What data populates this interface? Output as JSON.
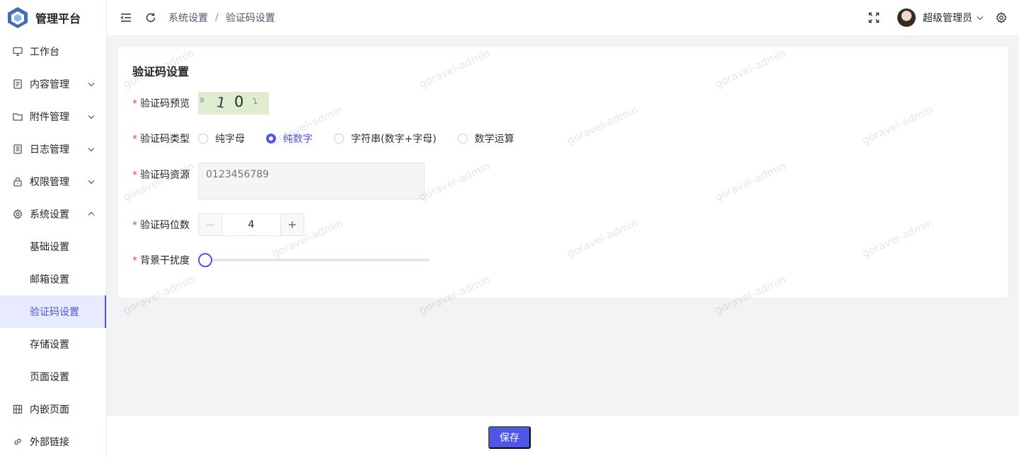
{
  "app": {
    "title": "管理平台"
  },
  "sidebar": {
    "items": [
      {
        "label": "工作台",
        "icon": "monitor-icon",
        "expandable": false
      },
      {
        "label": "内容管理",
        "icon": "document-icon",
        "expandable": true
      },
      {
        "label": "附件管理",
        "icon": "folder-icon",
        "expandable": true
      },
      {
        "label": "日志管理",
        "icon": "list-icon",
        "expandable": true
      },
      {
        "label": "权限管理",
        "icon": "lock-icon",
        "expandable": true
      },
      {
        "label": "系统设置",
        "icon": "gear-icon",
        "expandable": true,
        "expanded": true
      }
    ],
    "sub_items": [
      {
        "label": "基础设置"
      },
      {
        "label": "邮箱设置"
      },
      {
        "label": "验证码设置",
        "active": true
      },
      {
        "label": "存储设置"
      },
      {
        "label": "页面设置"
      }
    ],
    "bottom_items": [
      {
        "label": "内嵌页面",
        "icon": "table-icon"
      },
      {
        "label": "外部链接",
        "icon": "link-icon"
      }
    ]
  },
  "header": {
    "breadcrumb": [
      "系统设置",
      "验证码设置"
    ],
    "breadcrumb_sep": "/",
    "user_name": "超级管理员"
  },
  "form": {
    "title": "验证码设置",
    "required_mark": "*",
    "preview_label": "验证码预览",
    "preview_chars": [
      "9",
      "1",
      "0",
      "1"
    ],
    "type_label": "验证码类型",
    "type_options": [
      "纯字母",
      "纯数字",
      "字符串(数字+字母)",
      "数学运算"
    ],
    "type_selected": "纯数字",
    "source_label": "验证码资源",
    "source_placeholder": "0123456789",
    "length_label": "验证码位数",
    "length_value": "4",
    "noise_label": "背景干扰度",
    "noise_value": 0
  },
  "footer": {
    "save_label": "保存"
  },
  "watermark": {
    "text": "goravel-admin"
  },
  "colors": {
    "primary": "#4f55e6",
    "active_bg": "#e8ebff",
    "required": "#e5484d"
  }
}
